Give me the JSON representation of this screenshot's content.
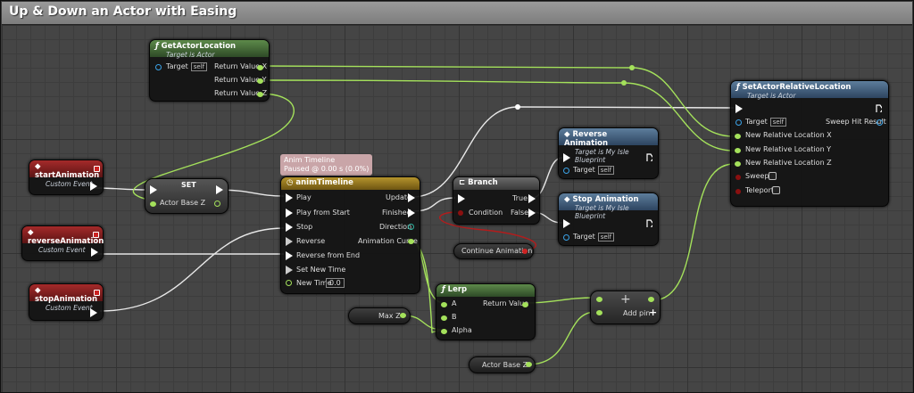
{
  "title": "Up & Down an Actor with Easing",
  "nodes": {
    "get_location": {
      "title": "GetActorLocation",
      "subtitle": "Target is Actor",
      "target": "Target",
      "self": "self",
      "out_x": "Return Value X",
      "out_y": "Return Value Y",
      "out_z": "Return Value Z"
    },
    "set_relative": {
      "title": "SetActorRelativeLocation",
      "subtitle": "Target is Actor",
      "target": "Target",
      "self": "self",
      "sweep_hit": "Sweep Hit Result",
      "in_x": "New Relative Location X",
      "in_y": "New Relative Location Y",
      "in_z": "New Relative Location Z",
      "sweep": "Sweep",
      "teleport": "Teleport"
    },
    "start_anim": {
      "title": "startAnimation",
      "subtitle": "Custom Event"
    },
    "reverse_anim": {
      "title": "reverseAnimation",
      "subtitle": "Custom Event"
    },
    "stop_anim": {
      "title": "stopAnimation",
      "subtitle": "Custom Event"
    },
    "set": {
      "title": "SET",
      "pin": "Actor Base Z"
    },
    "timeline": {
      "tooltip_1": "Anim Timeline",
      "tooltip_2": "Paused @ 0.00 s (0.0%)",
      "title": "animTimeline",
      "play": "Play",
      "play_start": "Play from Start",
      "stop": "Stop",
      "reverse": "Reverse",
      "reverse_end": "Reverse from End",
      "set_time": "Set New Time",
      "new_time": "New Time",
      "new_time_val": "0.0",
      "update": "Update",
      "finished": "Finished",
      "direction": "Direction",
      "anim_curve": "Animation Curve"
    },
    "branch": {
      "title": "Branch",
      "condition": "Condition",
      "true": "True",
      "false": "False"
    },
    "reverse_node": {
      "title": "Reverse Animation",
      "subtitle": "Target is My Isle Blueprint",
      "target": "Target",
      "self": "self"
    },
    "stop_node": {
      "title": "Stop Animation",
      "subtitle": "Target is My Isle Blueprint",
      "target": "Target",
      "self": "self"
    },
    "continue_anim": {
      "title": "Continue Animation"
    },
    "lerp": {
      "title": "Lerp",
      "a": "A",
      "b": "B",
      "alpha": "Alpha",
      "ret": "Return Value"
    },
    "max_z": {
      "title": "Max Z"
    },
    "actor_base_z": {
      "title": "Actor Base Z"
    },
    "add": {
      "symbol": "+",
      "add_pin": "Add pin"
    }
  },
  "colors": {
    "float_pin": "#a4e15b",
    "object_pin": "#3ba3e8",
    "bool_pin": "#8a1010",
    "exec_pin": "#ffffff"
  }
}
